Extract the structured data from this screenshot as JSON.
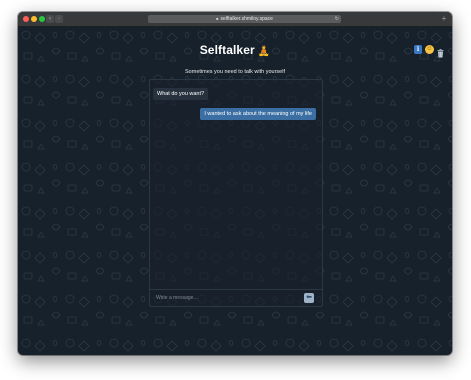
{
  "browser": {
    "url": "selftalker.shmiloy.space",
    "back_glyph": "‹",
    "forward_glyph": "›",
    "reload_glyph": "↻",
    "new_tab_glyph": "+"
  },
  "app": {
    "title": "Selftalker",
    "title_emoji": "🧘",
    "subtitle": "Sometimes you need to talk with yourself"
  },
  "top_actions": {
    "info_glyph": "i",
    "theme_glyph": "☺",
    "icons": [
      "info-icon",
      "theme-toggle-icon",
      "trash-icon"
    ]
  },
  "messages": [
    {
      "side": "left",
      "text": "What do you want?"
    },
    {
      "side": "right",
      "text": "I wanted to ask about the meaning of my life"
    }
  ],
  "composer": {
    "placeholder": "Write a message...",
    "send_glyph": "⬅"
  },
  "colors": {
    "page_bg": "#17212b",
    "bubble_left": "#27323e",
    "bubble_right": "#3b6fa3",
    "info_button": "#3a78c4",
    "theme_button": "#f6c342"
  }
}
